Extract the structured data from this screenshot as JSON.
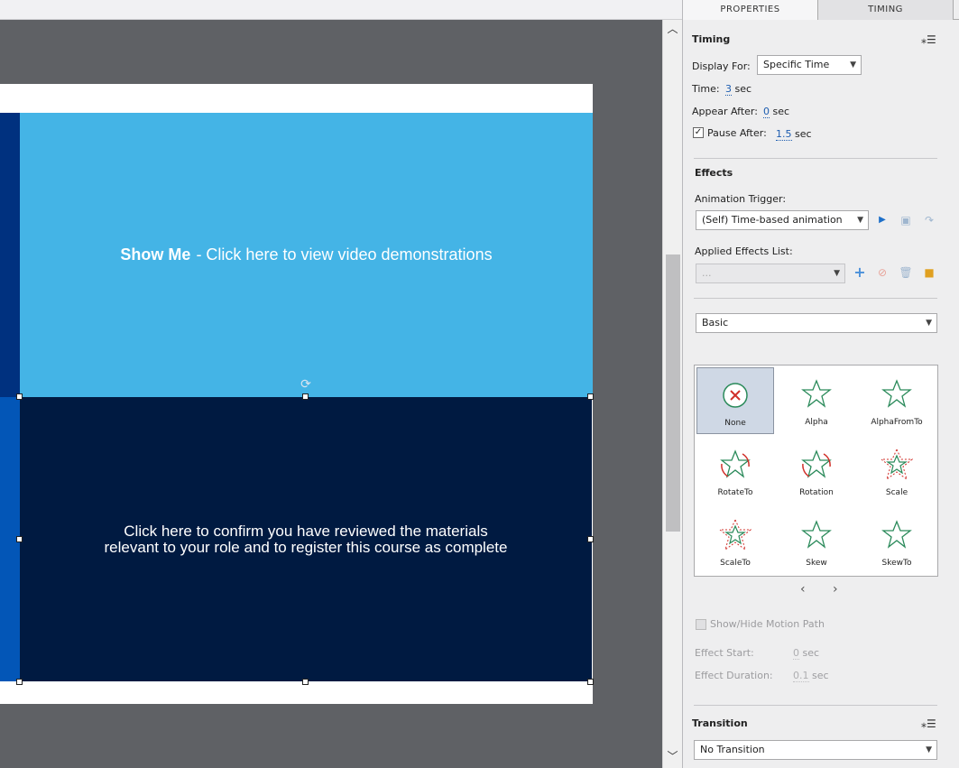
{
  "canvas": {
    "showme_bold": "Show Me",
    "showme_rest": "- Click here to view video demonstrations",
    "confirm_line1": "Click here to confirm you have reviewed the materials",
    "confirm_line2": "relevant to your role and to register this course as complete",
    "colors": {
      "light_blue": "#44b4e6",
      "dark_navy": "#001a41",
      "band_top": "#00317f",
      "band_bottom": "#0356b7"
    }
  },
  "tabs": [
    "PROPERTIES",
    "TIMING"
  ],
  "timing": {
    "title": "Timing",
    "display_for_label": "Display For:",
    "display_for_value": "Specific Time",
    "time_label": "Time:",
    "time_value": "3",
    "time_unit": "sec",
    "appear_after_label": "Appear After:",
    "appear_after_value": "0",
    "appear_after_unit": "sec",
    "pause_after_label": "Pause After:",
    "pause_after_value": "1.5",
    "pause_after_unit": "sec",
    "pause_after_checked": true
  },
  "effects": {
    "title": "Effects",
    "trigger_label": "Animation Trigger:",
    "trigger_value": "(Self) Time-based animation",
    "applied_label": "Applied Effects List:",
    "applied_value": "...",
    "category_value": "Basic",
    "items": [
      {
        "name": "None",
        "icon": "none-icon",
        "selected": true
      },
      {
        "name": "Alpha",
        "icon": "star-icon"
      },
      {
        "name": "AlphaFromTo",
        "icon": "star-icon"
      },
      {
        "name": "RotateTo",
        "icon": "star-rotate-icon"
      },
      {
        "name": "Rotation",
        "icon": "star-rotate-icon"
      },
      {
        "name": "Scale",
        "icon": "star-scale-icon"
      },
      {
        "name": "ScaleTo",
        "icon": "star-scale-icon"
      },
      {
        "name": "Skew",
        "icon": "star-icon"
      },
      {
        "name": "SkewTo",
        "icon": "star-icon"
      }
    ],
    "motion_path_label": "Show/Hide Motion Path",
    "effect_start_label": "Effect Start:",
    "effect_start_value": "0",
    "effect_start_unit": "sec",
    "effect_duration_label": "Effect Duration:",
    "effect_duration_value": "0.1",
    "effect_duration_unit": "sec"
  },
  "transition": {
    "title": "Transition",
    "value": "No Transition"
  }
}
